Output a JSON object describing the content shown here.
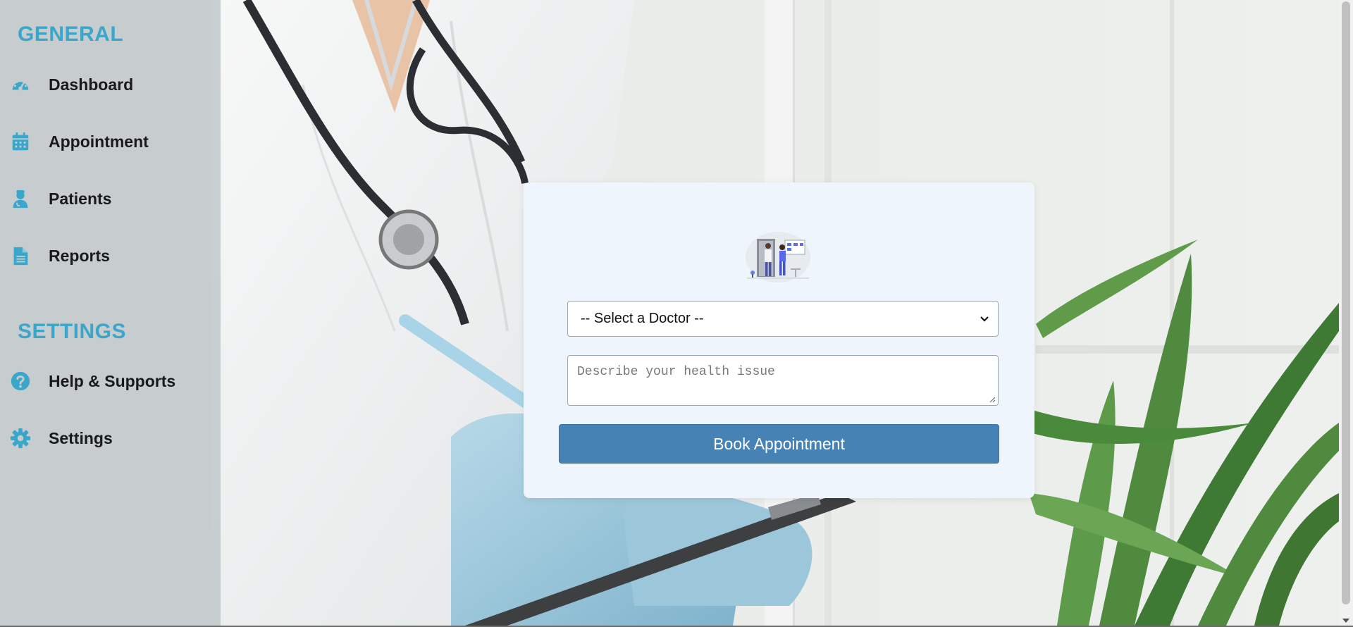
{
  "colors": {
    "accent": "#3aa6c9",
    "button": "#4682b4",
    "card_bg": "#eef5fc"
  },
  "sidebar": {
    "general_title": "GENERAL",
    "settings_title": "SETTINGS",
    "general_items": [
      {
        "label": "Dashboard",
        "icon": "dashboard-gauge-icon"
      },
      {
        "label": "Appointment",
        "icon": "calendar-icon"
      },
      {
        "label": "Patients",
        "icon": "patient-icon"
      },
      {
        "label": "Reports",
        "icon": "document-icon"
      }
    ],
    "settings_items": [
      {
        "label": "Help & Supports",
        "icon": "help-icon"
      },
      {
        "label": "Settings",
        "icon": "gear-icon"
      }
    ]
  },
  "booking": {
    "doctor_select_value": "-- Select a Doctor --",
    "issue_placeholder": "Describe your health issue",
    "submit_label": "Book Appointment",
    "illustration_icon": "doctor-office-illustration"
  }
}
